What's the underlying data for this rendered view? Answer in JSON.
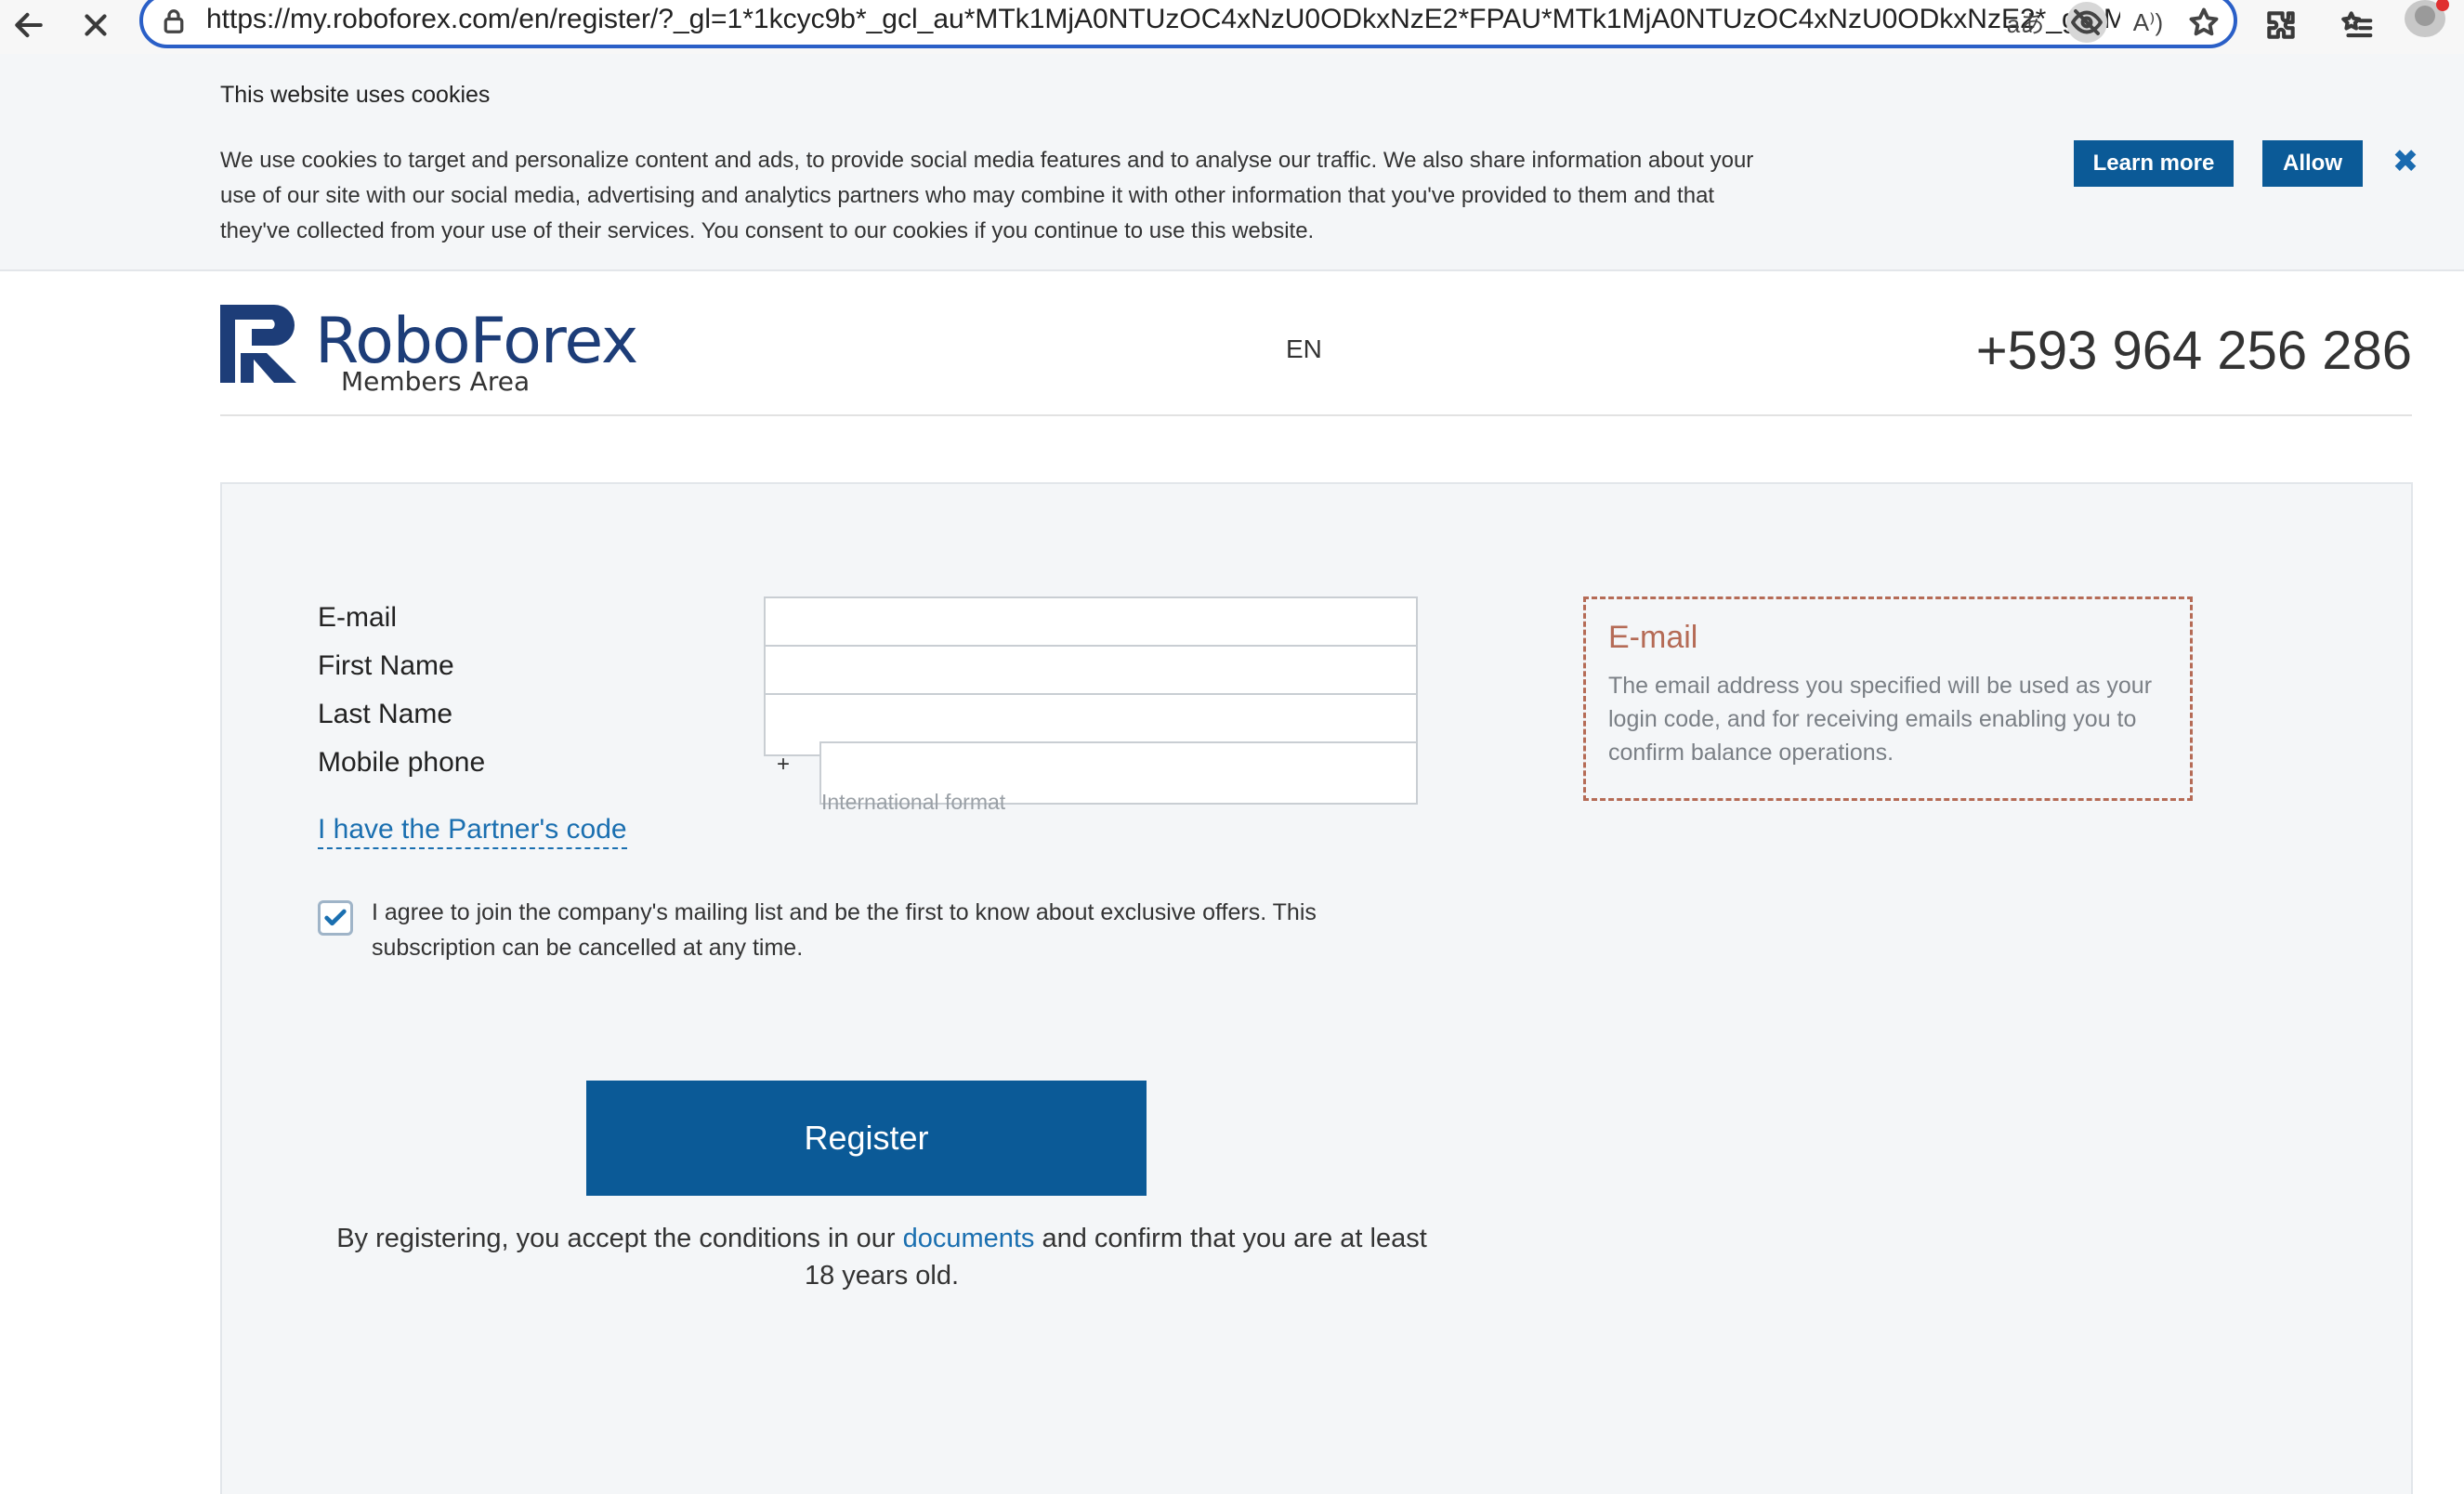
{
  "browser": {
    "url": "https://my.roboforex.com/en/register/?_gl=1*1kcyc9b*_gcl_au*MTk1MjA0NTUzOC4xNzU0ODkxNzE2*FPAU*MTk1MjA0NTUzOC4xNzU0ODkxNzE2*_ga*M...",
    "read_aloud_label": "aあ",
    "reader_label": "A⁾)"
  },
  "cookie_banner": {
    "title": "This website uses cookies",
    "text": "We use cookies to target and personalize content and ads, to provide social media features and to analyse our traffic. We also share information about your use of our site with our social media, advertising and analytics partners who may combine it with other information that you've provided to them and that they've collected from your use of their services. You consent to our cookies if you continue to use this website.",
    "learn_more": "Learn more",
    "allow": "Allow",
    "close": "✖"
  },
  "header": {
    "logo_name": "RoboForex",
    "logo_sub": "Members Area",
    "language": "EN",
    "phone": "+593 964 256 286"
  },
  "form": {
    "email_label": "E-mail",
    "email_value": "",
    "first_name_label": "First Name",
    "first_name_value": "",
    "last_name_label": "Last Name",
    "last_name_value": "",
    "phone_label": "Mobile phone",
    "phone_prefix": "+",
    "phone_value": "",
    "phone_hint": "International format",
    "partner_code_link": "I have the Partner's code",
    "mailing_checked": true,
    "mailing_text": "I agree to join the company's mailing list and be the first to know about exclusive offers. This subscription can be cancelled at any time.",
    "register_button": "Register",
    "terms_before": "By registering, you accept the conditions in our ",
    "terms_link": "documents",
    "terms_after": " and confirm that you are at least 18 years old."
  },
  "tip": {
    "title": "E-mail",
    "text": "The email address you specified will be used as your login code, and for receiving emails enabling you to confirm balance operations."
  },
  "colors": {
    "brand": "#1d3d78",
    "button": "#0b5a97",
    "link": "#1a6fb0",
    "tip_border": "#b56b56",
    "focus_ring": "#2a5fc7"
  }
}
